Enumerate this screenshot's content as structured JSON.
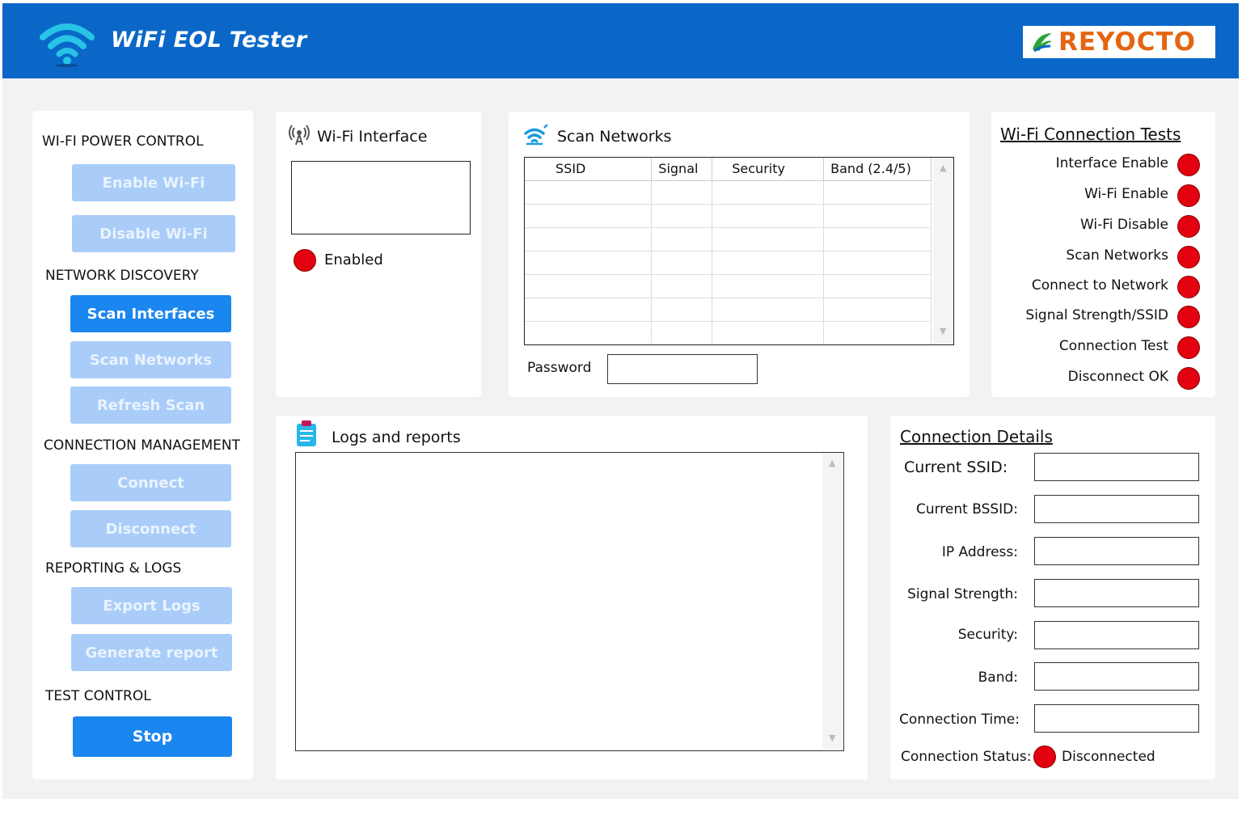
{
  "header": {
    "title": "WiFi EOL Tester",
    "brand": "REYOCTO",
    "brand_color": "#e46511",
    "bg_color": "#0a67c8"
  },
  "sidebar": {
    "power_section": "WI-FI POWER CONTROL",
    "enable_wifi": "Enable Wi-Fi",
    "disable_wifi": "Disable Wi-Fi",
    "discovery_section": "NETWORK DISCOVERY",
    "scan_interfaces": "Scan Interfaces",
    "scan_networks": "Scan Networks",
    "refresh_scan": "Refresh Scan",
    "connection_section": "CONNECTION MANAGEMENT",
    "connect": "Connect",
    "disconnect": "Disconnect",
    "reporting_section": "REPORTING & LOGS",
    "export_logs": "Export Logs",
    "generate_report": "Generate report",
    "test_section": "TEST CONTROL",
    "stop": "Stop"
  },
  "interface_panel": {
    "title": "Wi-Fi Interface",
    "status_label": "Enabled",
    "icon": "antenna-icon"
  },
  "scan_panel": {
    "title": "Scan Networks",
    "columns": [
      "SSID",
      "Signal",
      "Security",
      "Band (2.4/5)"
    ],
    "password_label": "Password",
    "password_value": "",
    "icon": "wifi-scan-icon"
  },
  "tests_panel": {
    "title": "Wi-Fi Connection Tests",
    "items": [
      "Interface Enable",
      "Wi-Fi Enable",
      "Wi-Fi Disable",
      "Scan Networks",
      "Connect to Network",
      "Signal Strength/SSID",
      "Connection Test",
      "Disconnect OK"
    ],
    "status_color": "#e3000f"
  },
  "logs_panel": {
    "title": "Logs and reports",
    "content": "",
    "icon": "clipboard-icon"
  },
  "details_panel": {
    "title": "Connection Details",
    "current_ssid_label": "Current SSID:",
    "current_bssid_label": "Current BSSID:",
    "ip_address_label": "IP Address:",
    "signal_strength_label": "Signal Strength:",
    "security_label": "Security:",
    "band_label": "Band:",
    "connection_time_label": "Connection Time:",
    "connection_status_label": "Connection Status:",
    "connection_status_value": "Disconnected"
  }
}
